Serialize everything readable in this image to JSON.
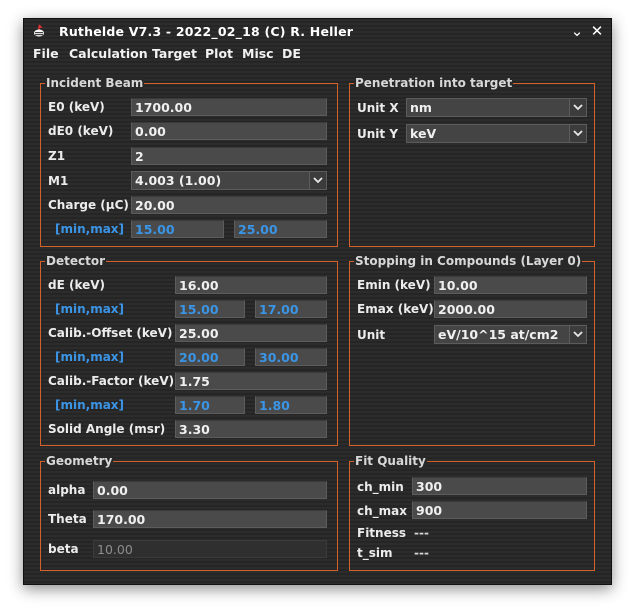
{
  "window": {
    "title": "Ruthelde V7.3 - 2022_02_18 (C) R. Heller",
    "minimize": "⌄",
    "close": "✕"
  },
  "menu": [
    "File",
    "Calculation",
    "Target",
    "Plot",
    "Misc",
    "DE"
  ],
  "incident_beam": {
    "legend": "Incident Beam",
    "e0_label": "E0 (keV)",
    "e0": "1700.00",
    "de0_label": "dE0 (keV)",
    "de0": "0.00",
    "z1_label": "Z1",
    "z1": "2",
    "m1_label": "M1",
    "m1": "4.003 (1.00)",
    "charge_label": "Charge (µC)",
    "charge": "20.00",
    "minmax_label": "[min,max]",
    "charge_min": "15.00",
    "charge_max": "25.00"
  },
  "penetration": {
    "legend": "Penetration into target",
    "unit_x_label": "Unit X",
    "unit_x": "nm",
    "unit_y_label": "Unit Y",
    "unit_y": "keV"
  },
  "detector": {
    "legend": "Detector",
    "de_label": "dE (keV)",
    "de": "16.00",
    "minmax_label": "[min,max]",
    "de_min": "15.00",
    "de_max": "17.00",
    "offset_label": "Calib.-Offset (keV)",
    "offset": "25.00",
    "offset_min": "20.00",
    "offset_max": "30.00",
    "factor_label": "Calib.-Factor (keV)",
    "factor": "1.75",
    "factor_min": "1.70",
    "factor_max": "1.80",
    "solid_angle_label": "Solid Angle (msr)",
    "solid_angle": "3.30"
  },
  "stopping": {
    "legend": "Stopping in Compounds (Layer 0)",
    "emin_label": "Emin (keV)",
    "emin": "10.00",
    "emax_label": "Emax (keV)",
    "emax": "2000.00",
    "unit_label": "Unit",
    "unit": "eV/10^15 at/cm2"
  },
  "geometry": {
    "legend": "Geometry",
    "alpha_label": "alpha",
    "alpha": "0.00",
    "theta_label": "Theta",
    "theta": "170.00",
    "beta_label": "beta",
    "beta": "10.00"
  },
  "fit_quality": {
    "legend": "Fit Quality",
    "ch_min_label": "ch_min",
    "ch_min": "300",
    "ch_max_label": "ch_max",
    "ch_max": "900",
    "fitness_label": "Fitness",
    "fitness": "---",
    "t_sim_label": "t_sim",
    "t_sim": "---"
  }
}
